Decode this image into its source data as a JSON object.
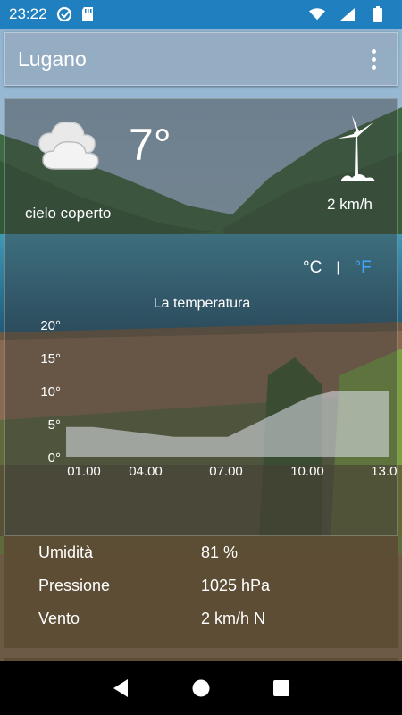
{
  "status_bar": {
    "time": "23:22",
    "icons_left": [
      "sync-icon",
      "sd-card-icon"
    ],
    "icons_right": [
      "wifi-icon",
      "signal-icon",
      "battery-icon"
    ]
  },
  "app_bar": {
    "title": "Lugano",
    "menu_icon": "more-vert-icon"
  },
  "weather": {
    "temperature": "7°",
    "condition": "cielo coperto",
    "condition_icon": "cloud-icon",
    "wind_icon": "wind-turbine-icon",
    "wind_speed": "2 km/h",
    "unit_celsius": "°C",
    "unit_separator": "|",
    "unit_fahrenheit": "°F",
    "active_unit": "°F",
    "accent_color": "#3fa9ff"
  },
  "chart_data": {
    "type": "area",
    "title": "La temperatura",
    "categories": [
      "01.00",
      "04.00",
      "07.00",
      "10.00",
      "13.00"
    ],
    "x": [
      "01.00",
      "02.00",
      "03.00",
      "04.00",
      "05.00",
      "06.00",
      "07.00",
      "08.00",
      "09.00",
      "10.00",
      "11.00",
      "12.00",
      "13.00"
    ],
    "values": [
      4.5,
      4.5,
      4,
      3.5,
      3,
      3,
      3,
      5,
      7,
      9,
      10,
      10,
      10
    ],
    "yticks": [
      "20°",
      "15°",
      "10°",
      "5°",
      "0°"
    ],
    "ylim": [
      0,
      20
    ],
    "grid": false
  },
  "details": {
    "humidity_label": "Umidità",
    "humidity_value": "81 %",
    "pressure_label": "Pressione",
    "pressure_value": "1025 hPa",
    "wind_label": "Vento",
    "wind_value": "2 km/h N"
  },
  "nav_bar": {
    "back_icon": "back-icon",
    "home_icon": "home-icon",
    "recents_icon": "recents-icon"
  }
}
